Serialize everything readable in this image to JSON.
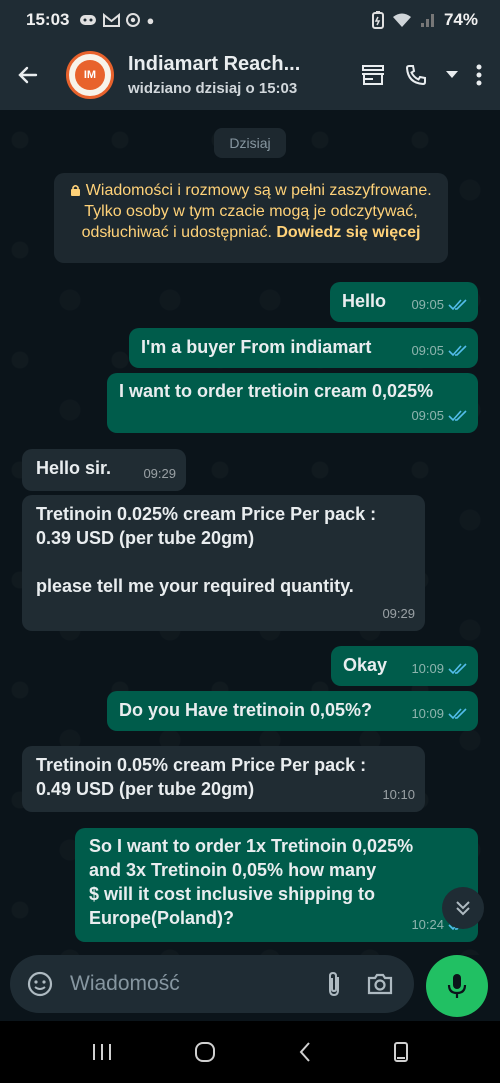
{
  "status": {
    "time": "15:03",
    "battery": "74%",
    "left_icons": [
      "discord-icon",
      "gmail-icon",
      "chrome-icon"
    ],
    "right_icons": [
      "battery-saver-icon",
      "wifi-icon",
      "signal-icon"
    ]
  },
  "header": {
    "contact_name": "Indiamart Reach...",
    "status_text": "widziano dzisiaj o 15:03",
    "avatar_letter": "IM"
  },
  "chat": {
    "date_chip": "Dzisiaj",
    "encryption": {
      "text": "Wiadomości i rozmowy są w pełni zaszyfrowane. Tylko osoby w tym czacie mogą je odczytywać, odsłuchiwać i udostępniać. ",
      "link": "Dowiedz się więcej"
    },
    "messages": [
      {
        "dir": "out",
        "text": "Hello",
        "time": "09:05",
        "read": true
      },
      {
        "dir": "out",
        "text": "I'm a buyer From indiamart",
        "time": "09:05",
        "read": true
      },
      {
        "dir": "out",
        "text": "I want to order tretioin cream 0,025%",
        "time": "09:05",
        "read": true
      },
      {
        "dir": "in",
        "text": "Hello sir.",
        "time": "09:29"
      },
      {
        "dir": "in",
        "text": "Tretinoin 0.025% cream Price Per pack :\n0.39 USD (per tube 20gm)\n\nplease tell me your required quantity.",
        "time": "09:29"
      },
      {
        "dir": "out",
        "text": "Okay",
        "time": "10:09",
        "read": true
      },
      {
        "dir": "out",
        "text": "Do you Have tretinoin 0,05%?",
        "time": "10:09",
        "read": true
      },
      {
        "dir": "in",
        "text": "Tretinoin 0.05% cream Price Per pack :\n0.49 USD (per tube 20gm)",
        "time": "10:10"
      },
      {
        "dir": "out",
        "text": "So I want to order 1x Tretinoin 0,025%\nand 3x Tretinoin 0,05% how many\n$ will it cost inclusive shipping to\nEurope(Poland)?",
        "time": "10:24",
        "read": true
      }
    ]
  },
  "input": {
    "placeholder": "Wiadomość"
  },
  "colors": {
    "outgoing": "#005c4b",
    "incoming": "#202c33",
    "accent": "#21c063",
    "read_tick": "#53bdeb"
  }
}
